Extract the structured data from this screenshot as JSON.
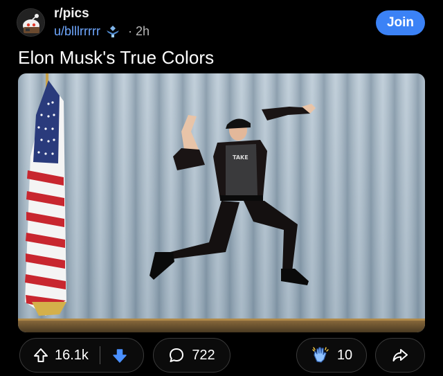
{
  "header": {
    "subreddit": "r/pics",
    "username": "u/blllrrrrr",
    "time": "· 2h",
    "join_label": "Join"
  },
  "post": {
    "title": "Elon Musk's True Colors"
  },
  "actions": {
    "upvotes": "16.1k",
    "comments": "722",
    "awards": "10"
  },
  "colors": {
    "background": "#000000",
    "accent": "#3b82f6",
    "username": "#6fa8ff",
    "downvote_active": "#4a90ff"
  },
  "icons": [
    "snoo-avatar-icon",
    "user-flair-icon",
    "upvote-arrow-icon",
    "downvote-arrow-icon",
    "comment-bubble-icon",
    "award-clapping-hands-icon",
    "share-arrow-icon"
  ]
}
